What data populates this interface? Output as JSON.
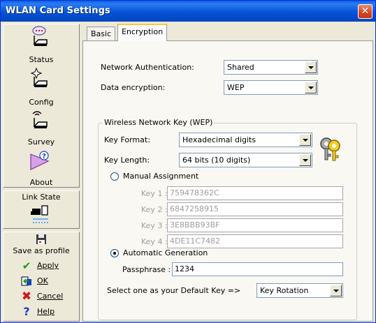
{
  "window": {
    "title": "WLAN Card Settings",
    "close_symbol": "✕"
  },
  "sidebar": {
    "nav": [
      {
        "label": "Status",
        "icon": "status-icon"
      },
      {
        "label": "Config",
        "icon": "config-icon"
      },
      {
        "label": "Survey",
        "icon": "survey-icon"
      },
      {
        "label": "About",
        "icon": "about-icon"
      }
    ],
    "link_state": {
      "label": "Link State",
      "icon": "link-state-icon"
    },
    "actions": {
      "save_profile": "Save as profile",
      "apply": "Apply",
      "ok": "OK",
      "cancel": "Cancel",
      "help": "Help"
    }
  },
  "tabs": [
    {
      "label": "Basic",
      "active": false
    },
    {
      "label": "Encryption",
      "active": true
    }
  ],
  "encryption": {
    "network_auth_label": "Network Authentication:",
    "network_auth_value": "Shared",
    "data_enc_label": "Data encryption:",
    "data_enc_value": "WEP",
    "wep_group_title": "Wireless Network Key (WEP)",
    "key_format_label": "Key Format:",
    "key_format_value": "Hexadecimal digits",
    "key_length_label": "Key Length:",
    "key_length_value": "64 bits (10 digits)",
    "manual_label": "Manual Assignment",
    "manual_selected": false,
    "keys": [
      {
        "label": "Key 1 :",
        "value": "759478362C"
      },
      {
        "label": "Key 2 :",
        "value": "6847258915"
      },
      {
        "label": "Key 3 :",
        "value": "3E8BBB93BF"
      },
      {
        "label": "Key 4 :",
        "value": "4DE11C7482"
      }
    ],
    "auto_label": "Automatic Generation",
    "auto_selected": true,
    "passphrase_label": "Passphrase :",
    "passphrase_value": "1234",
    "default_key_label": "Select one as your Default Key =>",
    "default_key_value": "Key Rotation"
  },
  "colors": {
    "titlebar": "#0453d6",
    "close": "#d4461f",
    "apply_check": "#1a9a1a",
    "cancel_x": "#d01818",
    "help_q": "#1a3fc0",
    "tab_highlight": "#ffc83c"
  }
}
